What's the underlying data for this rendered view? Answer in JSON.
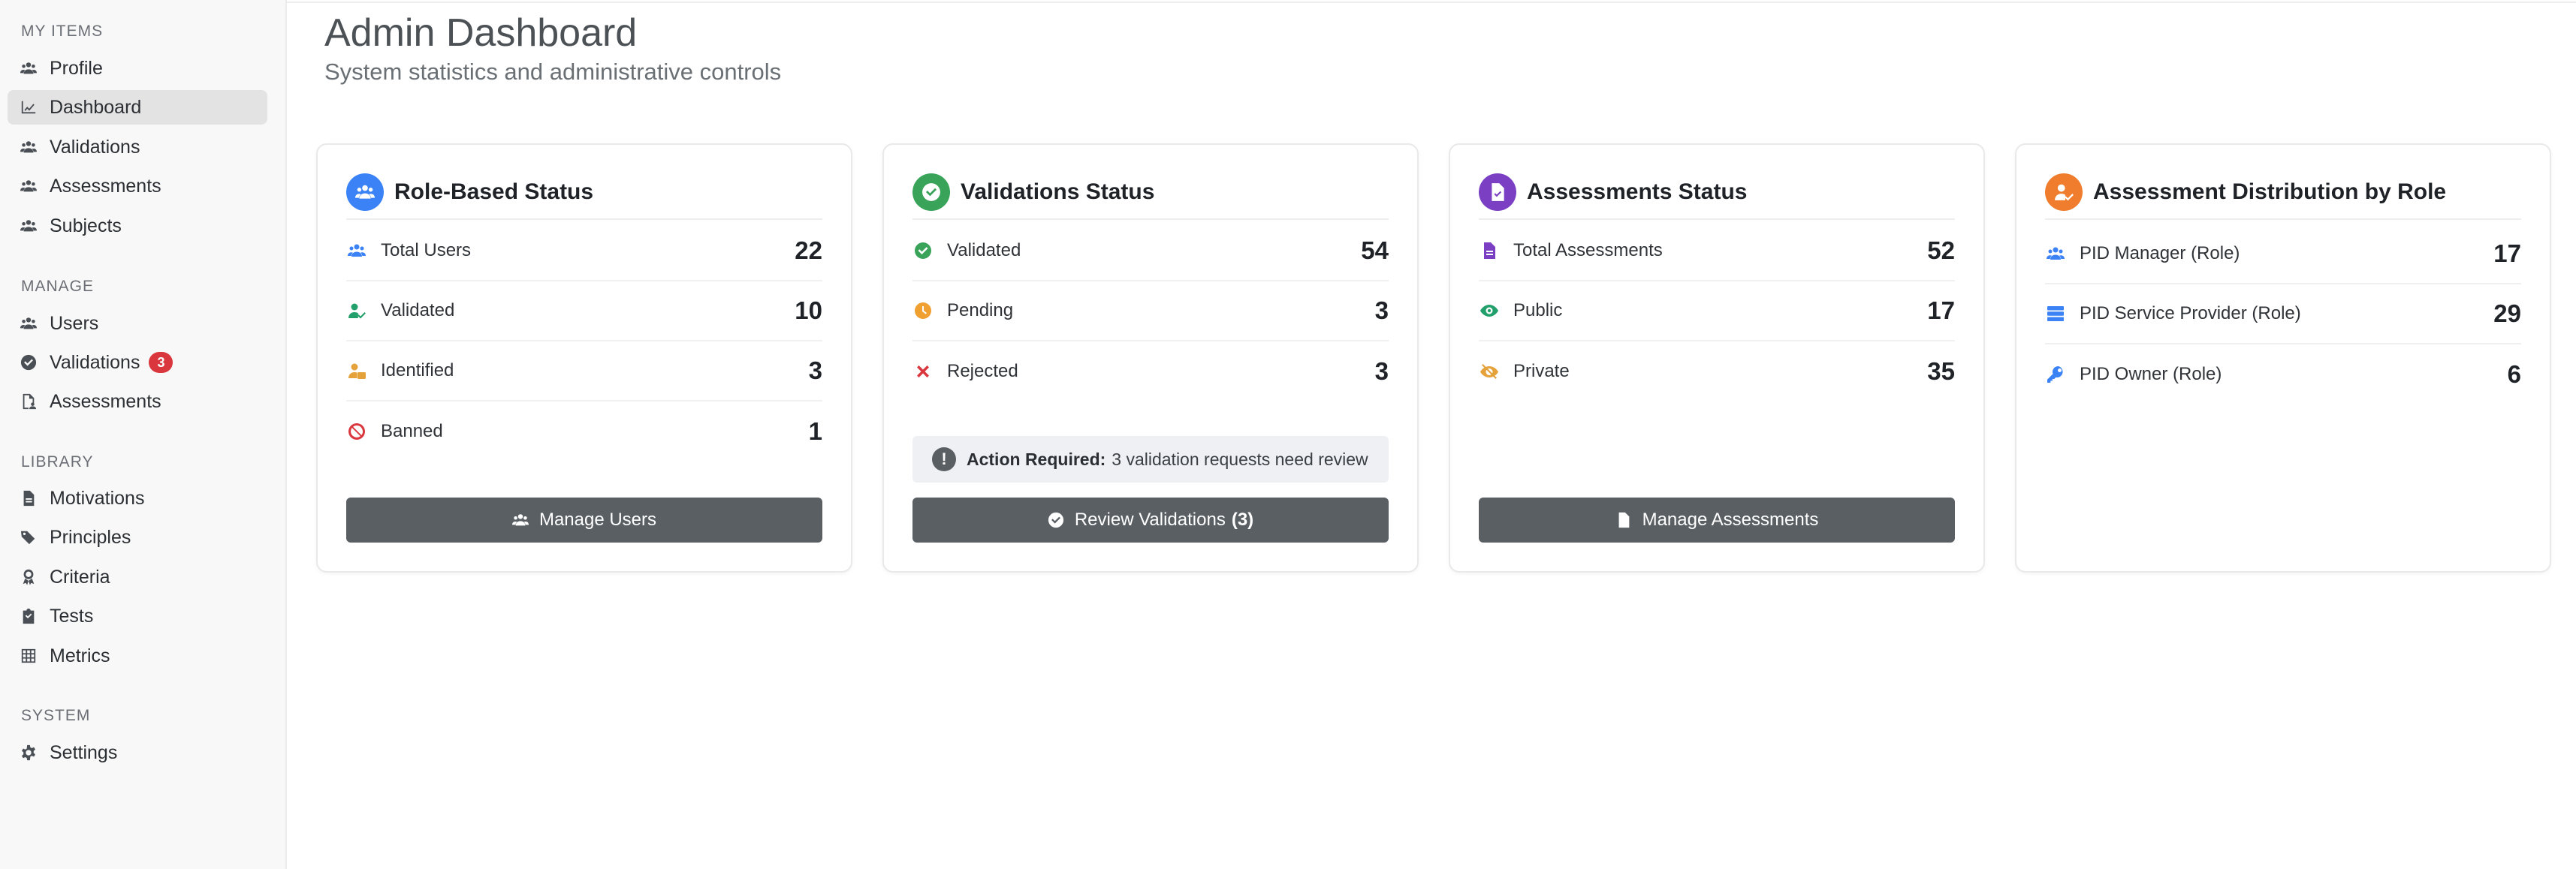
{
  "sidebar": {
    "sections": {
      "my_items": "MY ITEMS",
      "manage": "MANAGE",
      "library": "LIBRARY",
      "system": "SYSTEM"
    },
    "my_items": [
      {
        "label": "Profile",
        "icon": "users-icon"
      },
      {
        "label": "Dashboard",
        "icon": "chart-icon",
        "active": true
      },
      {
        "label": "Validations",
        "icon": "users-icon"
      },
      {
        "label": "Assessments",
        "icon": "users-icon"
      },
      {
        "label": "Subjects",
        "icon": "users-icon"
      }
    ],
    "manage": [
      {
        "label": "Users",
        "icon": "users-icon"
      },
      {
        "label": "Validations",
        "icon": "check-circle-icon",
        "badge": "3"
      },
      {
        "label": "Assessments",
        "icon": "file-user-icon"
      }
    ],
    "library": [
      {
        "label": "Motivations",
        "icon": "file-icon"
      },
      {
        "label": "Principles",
        "icon": "tags-icon"
      },
      {
        "label": "Criteria",
        "icon": "award-icon"
      },
      {
        "label": "Tests",
        "icon": "clipboard-icon"
      },
      {
        "label": "Metrics",
        "icon": "table-icon"
      }
    ],
    "system": [
      {
        "label": "Settings",
        "icon": "gear-icon"
      }
    ]
  },
  "header": {
    "title": "Admin Dashboard",
    "subtitle": "System statistics and administrative controls"
  },
  "cards": {
    "role_status": {
      "title": "Role-Based Status",
      "color": "#3b82f6",
      "rows": [
        {
          "label": "Total Users",
          "value": "22",
          "icon": "users-icon",
          "color": "#3b82f6"
        },
        {
          "label": "Validated",
          "value": "10",
          "icon": "user-check-icon",
          "color": "#22a06b"
        },
        {
          "label": "Identified",
          "value": "3",
          "icon": "user-id-icon",
          "color": "#e5a13a"
        },
        {
          "label": "Banned",
          "value": "1",
          "icon": "ban-icon",
          "color": "#d9363e"
        }
      ],
      "button": "Manage Users"
    },
    "validations_status": {
      "title": "Validations Status",
      "color": "#3aa35a",
      "rows": [
        {
          "label": "Validated",
          "value": "54",
          "icon": "check-circle-icon",
          "color": "#3aa35a"
        },
        {
          "label": "Pending",
          "value": "3",
          "icon": "clock-icon",
          "color": "#f0a030"
        },
        {
          "label": "Rejected",
          "value": "3",
          "icon": "x-icon",
          "color": "#d9363e"
        }
      ],
      "alert_strong": "Action Required:",
      "alert_text": "3 validation requests need review",
      "button": "Review Validations",
      "button_count": "(3)"
    },
    "assessments_status": {
      "title": "Assessments Status",
      "color": "#7b3fc4",
      "rows": [
        {
          "label": "Total Assessments",
          "value": "52",
          "icon": "file-icon",
          "color": "#7b3fc4"
        },
        {
          "label": "Public",
          "value": "17",
          "icon": "eye-icon",
          "color": "#22a06b"
        },
        {
          "label": "Private",
          "value": "35",
          "icon": "eye-slash-icon",
          "color": "#e5a13a"
        }
      ],
      "button": "Manage Assessments"
    },
    "distribution": {
      "title": "Assessment Distribution by Role",
      "color": "#f07d2d",
      "rows": [
        {
          "label": "PID Manager (Role)",
          "value": "17",
          "icon": "users-icon",
          "color": "#3b82f6"
        },
        {
          "label": "PID Service Provider (Role)",
          "value": "29",
          "icon": "server-icon",
          "color": "#3b82f6"
        },
        {
          "label": "PID Owner (Role)",
          "value": "6",
          "icon": "key-icon",
          "color": "#3b82f6"
        }
      ]
    }
  }
}
